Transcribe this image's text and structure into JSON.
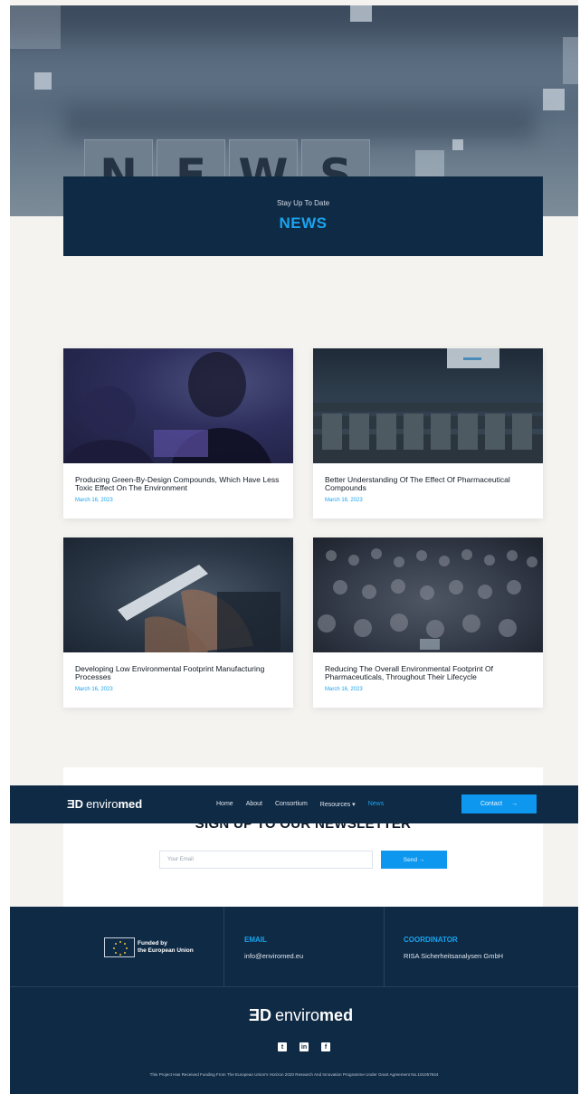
{
  "hero": {
    "letters": [
      "N",
      "E",
      "W",
      "S"
    ],
    "subtitle": "Stay Up To Date",
    "title": "NEWS"
  },
  "posts": [
    {
      "title": "Producing Green-By-Design Compounds, Which Have Less Toxic Effect On The Environment",
      "date": "March 16, 2023"
    },
    {
      "title": "Better Understanding Of The Effect Of Pharmaceutical Compounds",
      "date": "March 16, 2023"
    },
    {
      "title": "Developing Low Environmental Footprint Manufacturing Processes",
      "date": "March 16, 2023"
    },
    {
      "title": "Reducing The Overall Environmental Footprint Of Pharmaceuticals, Throughout Their Lifecycle",
      "date": "March 16, 2023"
    }
  ],
  "header": {
    "logo_mark": "ƎD",
    "logo_light": "enviro",
    "logo_bold": "med",
    "nav": [
      {
        "label": "Home"
      },
      {
        "label": "About"
      },
      {
        "label": "Consortium"
      },
      {
        "label": "Resources ▾"
      },
      {
        "label": "News"
      }
    ],
    "contact_label": "Contact",
    "contact_arrow": "→"
  },
  "newsletter": {
    "heading": "SIGN UP TO OUR NEWSLETTER",
    "email_placeholder": "Your Email",
    "send_label": "Send →"
  },
  "footer": {
    "funded_line1": "Funded by",
    "funded_line2": "the European Union",
    "email_label": "EMAIL",
    "email_value": "info@enviromed.eu",
    "coordinator_label": "COORDINATOR",
    "coordinator_value": "RISA Sicherheitsanalysen GmbH",
    "social": [
      "t",
      "in",
      "f"
    ],
    "fineprint": "This Project Has Received Funding From The European Union's Horizon 2020 Research And Innovation Programme Under Grant Agreement No.101057844"
  },
  "colors": {
    "navy": "#0f2a45",
    "accent": "#1aa3ee",
    "button": "#0e97ee",
    "page_bg": "#f4f3f0"
  },
  "icons": [
    "arrow-right-icon",
    "caret-down-icon",
    "eu-flag-icon",
    "twitter-icon",
    "linkedin-icon",
    "facebook-icon"
  ]
}
